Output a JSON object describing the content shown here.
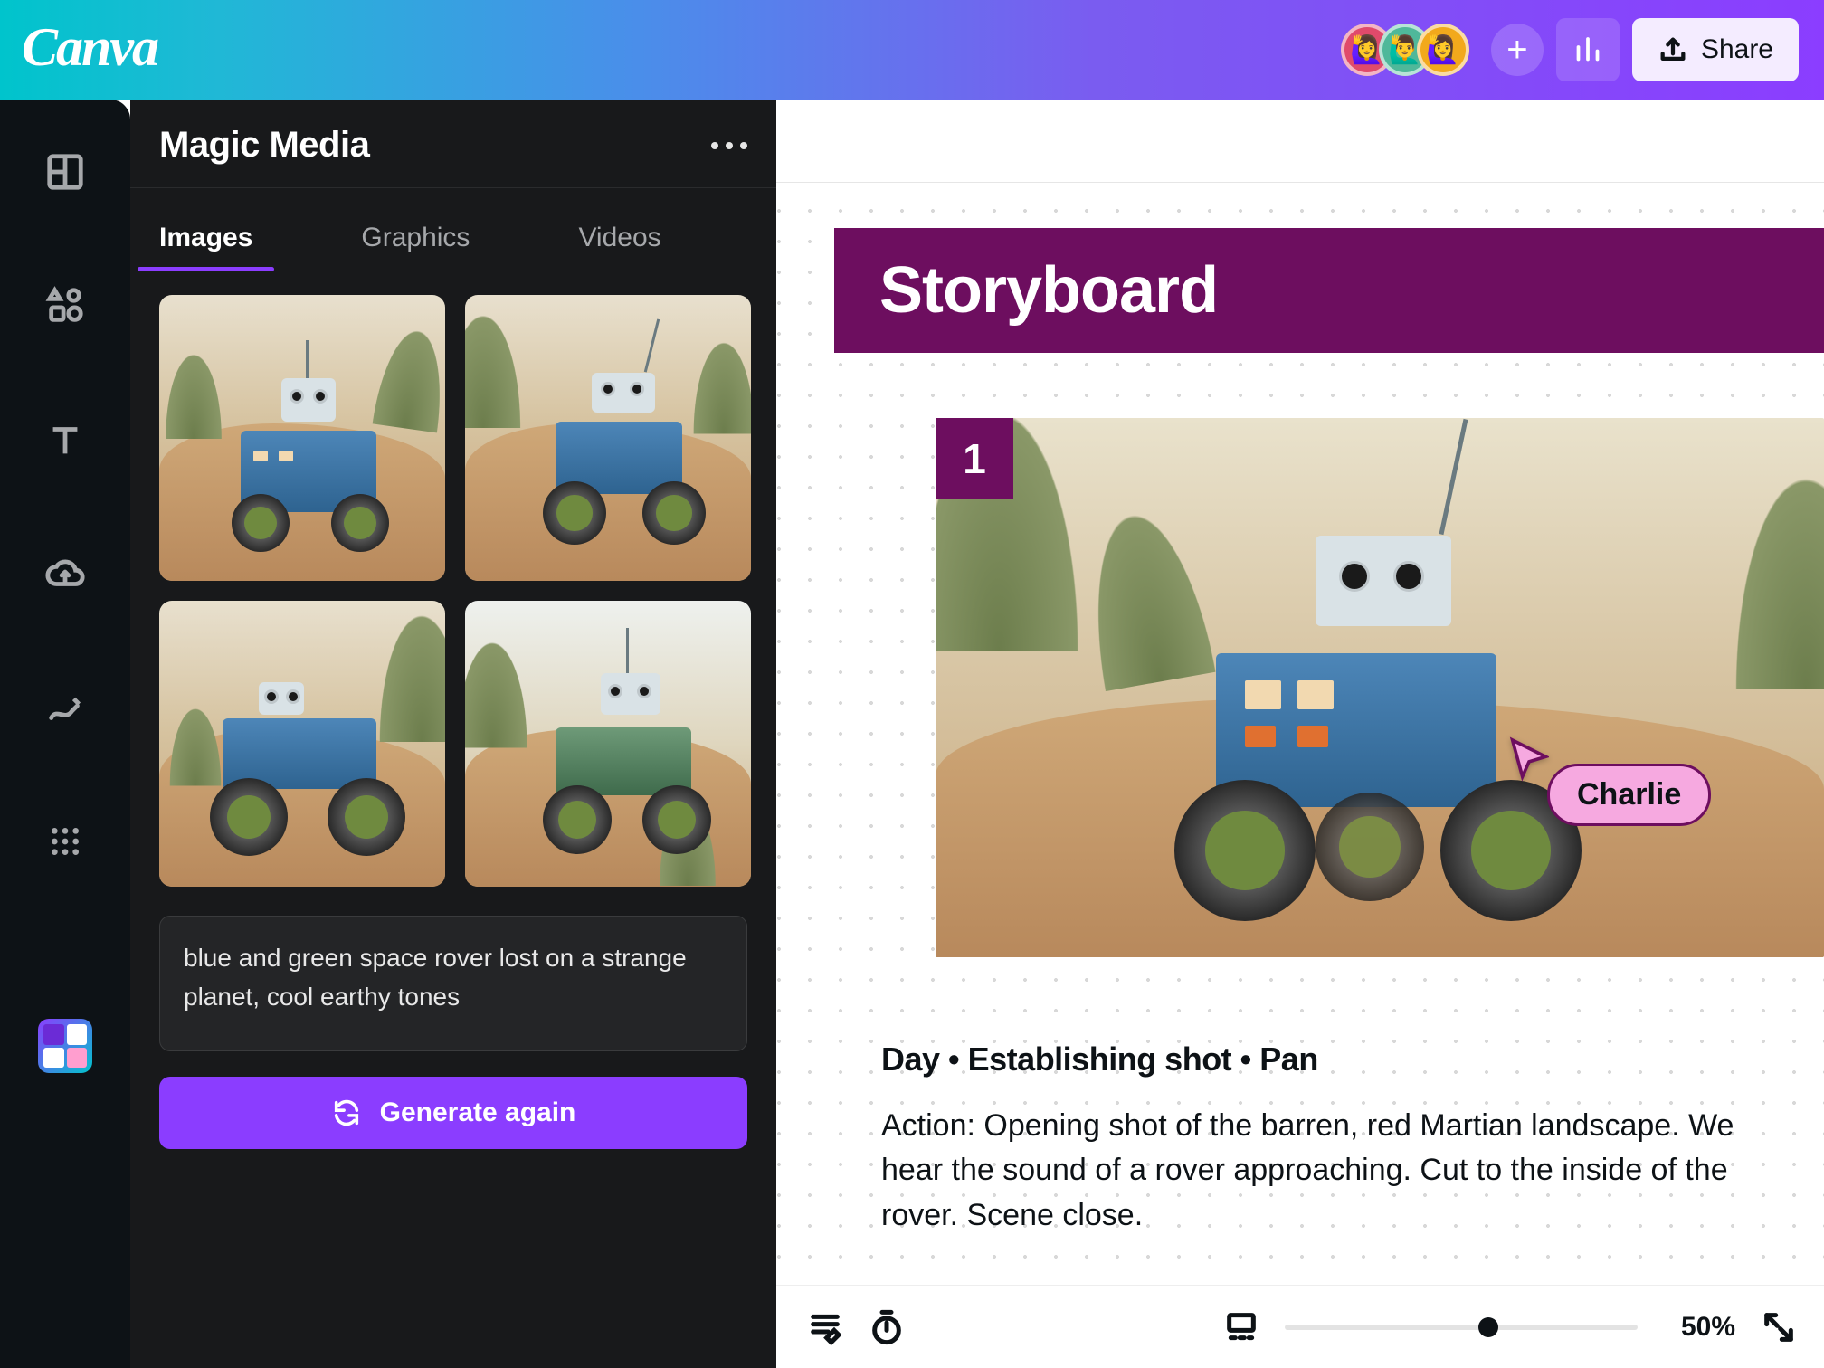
{
  "header": {
    "logo_text": "Canva",
    "share_label": "Share",
    "avatar_colors": [
      "#e04a6b",
      "#4fb89a",
      "#f2a91c"
    ]
  },
  "panel": {
    "title": "Magic Media",
    "tabs": {
      "images": "Images",
      "graphics": "Graphics",
      "videos": "Videos",
      "active": "images"
    },
    "prompt_text": "blue and green space rover lost on a strange planet, cool earthy tones",
    "generate_label": "Generate again"
  },
  "canvas": {
    "storyboard_title": "Storyboard",
    "frame_number": "1",
    "collaborator_name": "Charlie",
    "shot_meta": "Day • Establishing shot • Pan",
    "shot_action": "Action: Opening shot of the barren, red Martian landscape. We hear the sound of a rover approaching. Cut to the inside of the rover. Scene close.",
    "zoom_label": "50%",
    "zoom_value": 0.55
  }
}
